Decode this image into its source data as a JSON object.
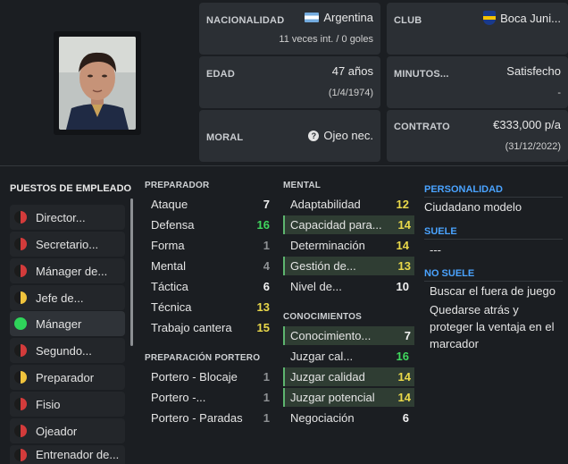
{
  "info": {
    "nationality": {
      "label": "NACIONALIDAD",
      "value": "Argentina",
      "sub": "11 veces int. / 0 goles"
    },
    "club": {
      "label": "CLUB",
      "value": "Boca Juni..."
    },
    "age": {
      "label": "EDAD",
      "value": "47 años",
      "sub": "(1/4/1974)"
    },
    "minutes": {
      "label": "MINUTOS...",
      "value": "Satisfecho",
      "sub": "-"
    },
    "morale": {
      "label": "MORAL",
      "value": "Ojeo nec."
    },
    "contract": {
      "label": "CONTRATO",
      "value": "€333,000 p/a",
      "sub": "(31/12/2022)"
    }
  },
  "positions": {
    "title": "PUESTOS DE EMPLEADO",
    "items": [
      {
        "label": "Director...",
        "dot": "red"
      },
      {
        "label": "Secretario...",
        "dot": "red"
      },
      {
        "label": "Mánager de...",
        "dot": "red"
      },
      {
        "label": "Jefe de...",
        "dot": "yellow"
      },
      {
        "label": "Mánager",
        "dot": "green"
      },
      {
        "label": "Segundo...",
        "dot": "red"
      },
      {
        "label": "Preparador",
        "dot": "yellow"
      },
      {
        "label": "Fisio",
        "dot": "red"
      },
      {
        "label": "Ojeador",
        "dot": "red"
      },
      {
        "label": "Entrenador de...",
        "dot": "red"
      }
    ]
  },
  "preparador": {
    "title": "PREPARADOR",
    "attrs": [
      {
        "name": "Ataque",
        "value": "7"
      },
      {
        "name": "Defensa",
        "value": "16"
      },
      {
        "name": "Forma",
        "value": "1"
      },
      {
        "name": "Mental",
        "value": "4"
      },
      {
        "name": "Táctica",
        "value": "6"
      },
      {
        "name": "Técnica",
        "value": "13"
      },
      {
        "name": "Trabajo cantera",
        "value": "15"
      }
    ]
  },
  "portero": {
    "title": "PREPARACIÓN PORTERO",
    "attrs": [
      {
        "name": "Portero - Blocaje",
        "value": "1"
      },
      {
        "name": "Portero -...",
        "value": "1"
      },
      {
        "name": "Portero - Paradas",
        "value": "1"
      }
    ]
  },
  "mental": {
    "title": "MENTAL",
    "attrs": [
      {
        "name": "Adaptabilidad",
        "value": "12"
      },
      {
        "name": "Capacidad para...",
        "value": "14"
      },
      {
        "name": "Determinación",
        "value": "14"
      },
      {
        "name": "Gestión de...",
        "value": "13"
      },
      {
        "name": "Nivel de...",
        "value": "10"
      }
    ]
  },
  "conocimientos": {
    "title": "CONOCIMIENTOS",
    "attrs": [
      {
        "name": "Conocimiento...",
        "value": "7"
      },
      {
        "name": "Juzgar cal...",
        "value": "16"
      },
      {
        "name": "Juzgar calidad",
        "value": "14"
      },
      {
        "name": "Juzgar potencial",
        "value": "14"
      },
      {
        "name": "Negociación",
        "value": "6"
      }
    ]
  },
  "personality": {
    "title": "PERSONALIDAD",
    "value": "Ciudadano modelo",
    "suele_title": "SUELE",
    "suele_value": "---",
    "nosuele_title": "NO SUELE",
    "nosuele_1": "Buscar el fuera de juego",
    "nosuele_2": "Quedarse atrás y proteger la ventaja en el marcador"
  }
}
